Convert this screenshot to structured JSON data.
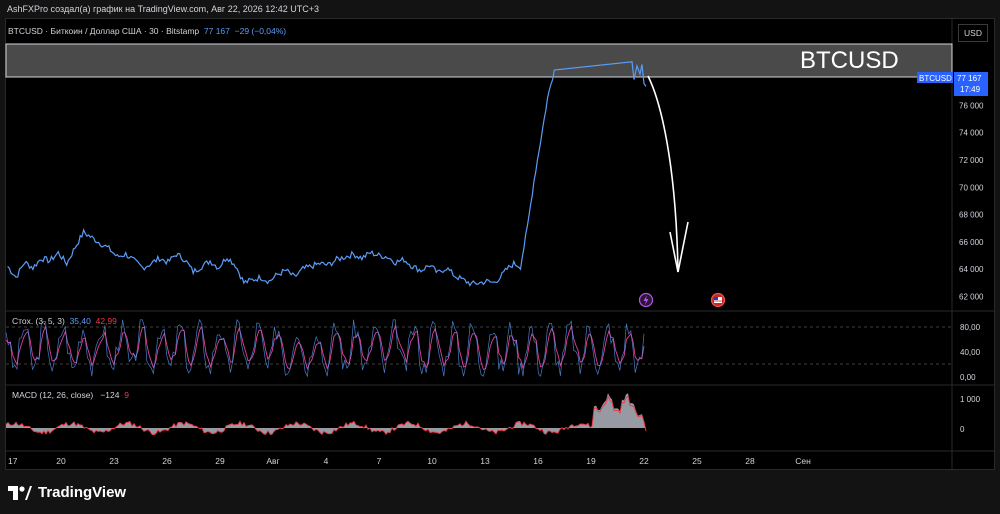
{
  "attribution": "AshFXPro создал(а) график на TradingView.com, Авг 22, 2026 12:42 UTC+3",
  "header": {
    "symbol_line": "BTCUSD · Биткоин / Доллар США · 30 · Bitstamp",
    "price": "77 167",
    "change": "−29 (−0,04%)"
  },
  "currency_button": "USD",
  "annotation_text": "BTCUSD",
  "price_tag": {
    "symbol": "BTCUSD",
    "price": "77 167",
    "countdown": "17:49"
  },
  "stoch": {
    "label": "Стох. (3, 5, 3)",
    "k": "35,40",
    "d": "42,99",
    "axis": [
      "80,00",
      "40,00",
      "0,00"
    ]
  },
  "macd": {
    "label": "MACD (12, 26, close)",
    "hist": "−124",
    "signal": "9",
    "axis": [
      "1 000",
      "0"
    ]
  },
  "brand": "TradingView",
  "colors": {
    "price_line": "#5b9cf6",
    "stoch_k": "#5b9cf6",
    "stoch_d": "#e040a0",
    "macd_hist": "#b2b5be",
    "macd_line": "#f23645",
    "zone_fill": "#4a4a4a"
  },
  "icons": [
    "lightning-event-icon",
    "us-flag-event-icon",
    "down-arrow-drawing-icon"
  ],
  "chart_data": {
    "type": "line",
    "title": "BTCUSD · Биткоин / Доллар США · 30 · Bitstamp",
    "x_ticks": [
      "17",
      "20",
      "23",
      "26",
      "29",
      "Авг",
      "4",
      "7",
      "10",
      "13",
      "16",
      "19",
      "22",
      "25",
      "28",
      "Сен"
    ],
    "y_ticks": [
      62000,
      64000,
      66000,
      68000,
      70000,
      72000,
      74000,
      76000,
      78000
    ],
    "y_tick_labels": [
      "62 000",
      "64 000",
      "66 000",
      "68 000",
      "70 000",
      "72 000",
      "74 000",
      "76 000",
      "78 000"
    ],
    "ylim": [
      61000,
      80800
    ],
    "xlim": [
      0,
      28
    ],
    "resistance_zone": [
      77500,
      79900
    ],
    "series": [
      {
        "name": "BTCUSD",
        "x": [
          0,
          0.5,
          1,
          1.5,
          2,
          2.5,
          3,
          3.5,
          4,
          4.5,
          5,
          5.5,
          6,
          6.5,
          7,
          7.5,
          8,
          8.5,
          9,
          9.5,
          10,
          10.5,
          11,
          11.5,
          12,
          12.5,
          13,
          13.5,
          14,
          14.5,
          15,
          15.5,
          16,
          16.5,
          17,
          17.5,
          18,
          18.5,
          19,
          19.5,
          20,
          20.5,
          21,
          21.5,
          22,
          22.5,
          23,
          23.5,
          24,
          24.5,
          25,
          25.5,
          26,
          26.5,
          27,
          27.5,
          28,
          28.4,
          28.8,
          29.2,
          29.6,
          30,
          30.4,
          30.8,
          31.2,
          31.6,
          32,
          32.4
        ],
        "values": [
          64200,
          63400,
          64500,
          64100,
          64800,
          64600,
          65200,
          64400,
          65600,
          66700,
          66300,
          65900,
          65500,
          64900,
          65100,
          64600,
          64100,
          64400,
          64800,
          64500,
          65100,
          64700,
          63800,
          64200,
          64600,
          64100,
          64900,
          64300,
          63000,
          63200,
          63400,
          63100,
          63600,
          63900,
          63400,
          64000,
          64200,
          64400,
          64300,
          64700,
          64900,
          65100,
          64800,
          65200,
          65000,
          64900,
          64500,
          64700,
          64200,
          63900,
          64300,
          63700,
          64100,
          63500,
          63200,
          62900,
          63000,
          63100,
          63000,
          63400,
          64000,
          64400,
          64200,
          67000,
          70500,
          73500,
          76500,
          78600
        ]
      }
    ],
    "stoch_k_last": 35.4,
    "stoch_d_last": 42.99,
    "macd_hist_last": -124,
    "macd_signal_last": 9
  }
}
